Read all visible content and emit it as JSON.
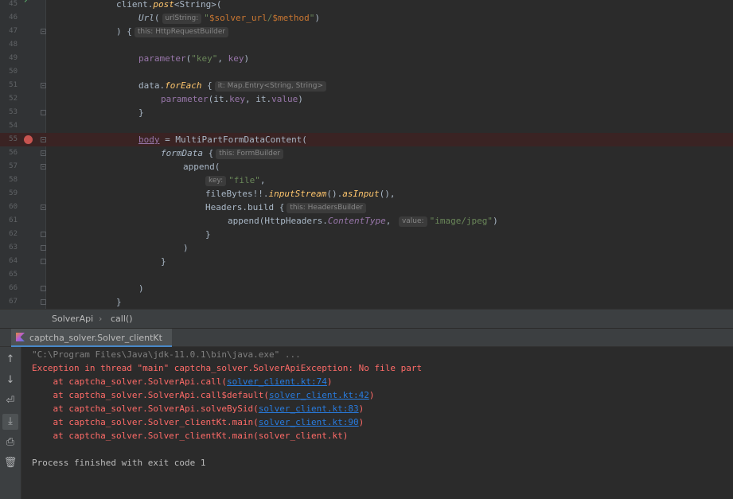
{
  "editor": {
    "line_numbers": [
      "45",
      "46",
      "47",
      "48",
      "49",
      "50",
      "51",
      "52",
      "53",
      "54",
      "55",
      "56",
      "57",
      "58",
      "59",
      "60",
      "61",
      "62",
      "63",
      "64",
      "65",
      "66",
      "67"
    ],
    "lines": {
      "l45": {
        "a": "client.",
        "b": "post",
        "c": "<String>("
      },
      "l46": {
        "a": "Url",
        "b": "(",
        "hint": "urlString:",
        "s1": "\"",
        "sv": "$solver_url",
        "s2": "/",
        "sv2": "$method",
        "s3": "\"",
        "e": ")"
      },
      "l47": {
        "a": ") {",
        "hint": "this: HttpRequestBuilder"
      },
      "l49": {
        "fn": "parameter",
        "a": "(",
        "s": "\"key\"",
        "b": ", ",
        "v": "key",
        "c": ")"
      },
      "l51": {
        "a": "data.",
        "fn": "forEach",
        "b": " {",
        "hint": "it: Map.Entry<String, String>"
      },
      "l52": {
        "fn": "parameter",
        "a": "(it.",
        "p1": "key",
        "b": ", it.",
        "p2": "value",
        "c": ")"
      },
      "l53": {
        "a": "}"
      },
      "l55": {
        "u": "body",
        "a": " = MultiPartFormDataContent("
      },
      "l56": {
        "fn": "formData",
        "a": " {",
        "hint": "this: FormBuilder"
      },
      "l57": {
        "a": "append("
      },
      "l58": {
        "hint": "key:",
        "s": "\"file\"",
        "a": ","
      },
      "l59": {
        "a": "fileBytes!!.",
        "fn1": "inputStream",
        "b": "().",
        "fn2": "asInput",
        "c": "(),"
      },
      "l60": {
        "a": "Headers.build {",
        "hint": "this: HeadersBuilder"
      },
      "l61": {
        "a": "append(HttpHeaders.",
        "p": "ContentType",
        "b": ", ",
        "hint": "value:",
        "s": "\"image/jpeg\"",
        "c": ")"
      },
      "l62": {
        "a": "}"
      },
      "l63": {
        "a": ")"
      },
      "l64": {
        "a": "}"
      },
      "l66": {
        "a": ")"
      },
      "l67": {
        "a": "}"
      }
    }
  },
  "breadcrumb": {
    "class": "SolverApi",
    "sep": "›",
    "method": "call()"
  },
  "run_tab": {
    "label": "captcha_solver.Solver_clientKt"
  },
  "toolbar": {
    "up": "↑",
    "down": "↓",
    "wrap": "⏎",
    "scroll": "⤓",
    "print": "⎙",
    "trash": "🗑"
  },
  "console": {
    "cmd": "\"C:\\Program Files\\Java\\jdk-11.0.1\\bin\\java.exe\" ...",
    "exception": "Exception in thread \"main\" captcha_solver.SolverApiException: No file part",
    "trace": [
      {
        "pre": "    at captcha_solver.SolverApi.call(",
        "link": "solver_client.kt:74",
        "post": ")"
      },
      {
        "pre": "    at captcha_solver.SolverApi.call$default(",
        "link": "solver_client.kt:42",
        "post": ")"
      },
      {
        "pre": "    at captcha_solver.SolverApi.solveBySid(",
        "link": "solver_client.kt:83",
        "post": ")"
      },
      {
        "pre": "    at captcha_solver.Solver_clientKt.main(",
        "link": "solver_client.kt:90",
        "post": ")"
      },
      {
        "pre": "    at captcha_solver.Solver_clientKt.main(solver_client.kt)",
        "link": "",
        "post": ""
      }
    ],
    "finished": "Process finished with exit code 1"
  }
}
